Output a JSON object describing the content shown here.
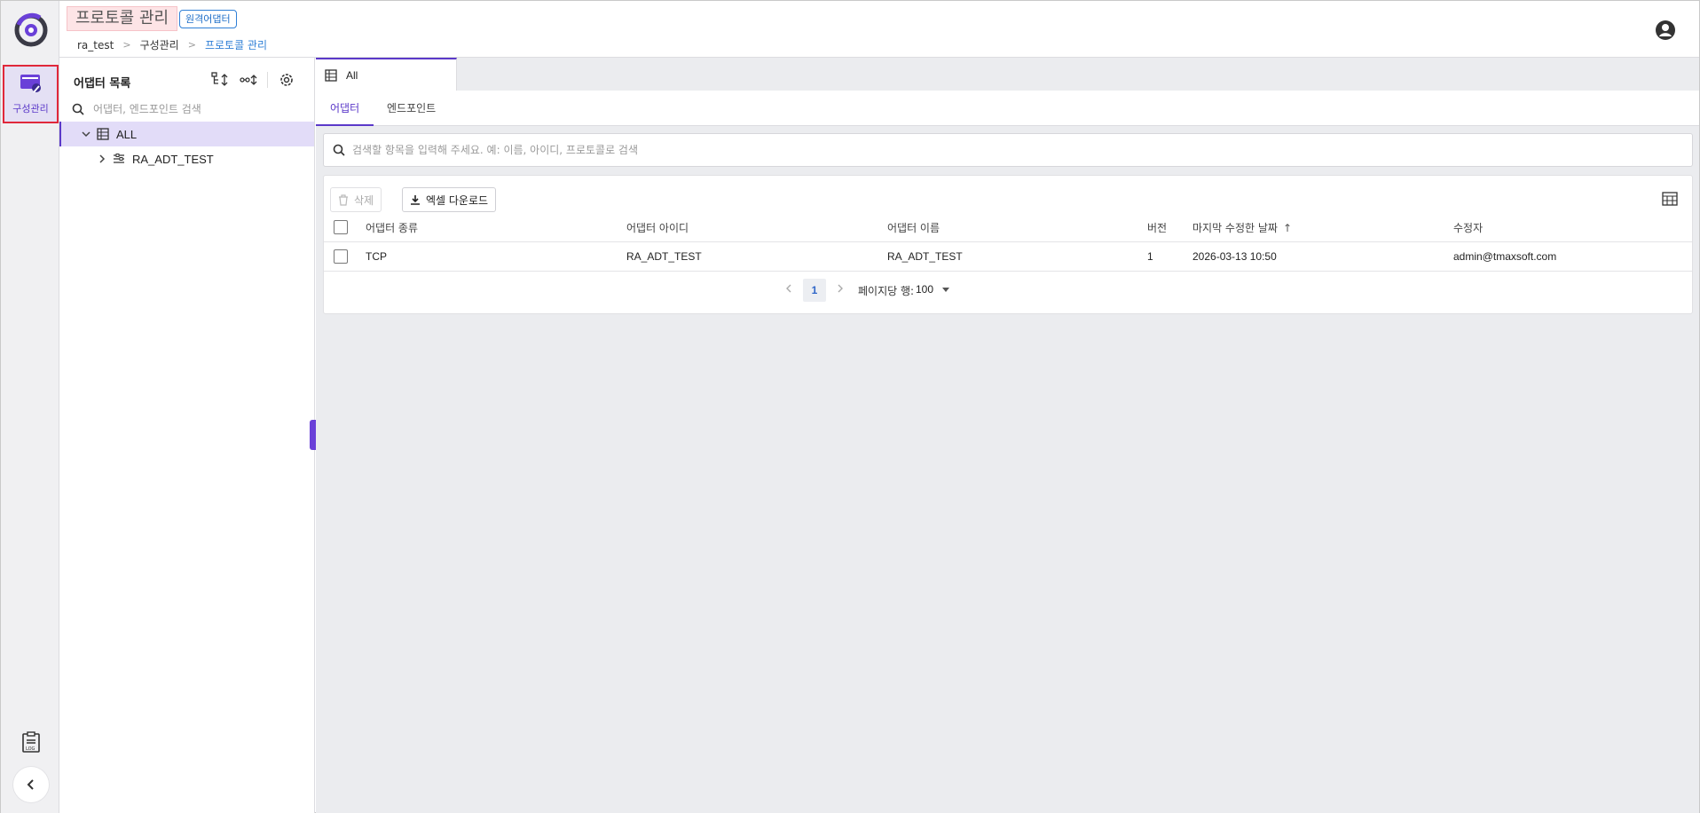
{
  "header": {
    "title": "프로토콜 관리",
    "badge": "원격어댑터",
    "breadcrumb": [
      "ra_test",
      "구성관리",
      "프로토콜 관리"
    ]
  },
  "rail": {
    "items": [
      {
        "label": "구성관리",
        "icon": "config-management-icon",
        "active": true
      }
    ],
    "log_icon": "log-icon",
    "collapse_icon": "chevron-left-icon"
  },
  "side_panel": {
    "title": "어댑터 목록",
    "search_placeholder": "어댑터, 엔드포인트 검색",
    "tree": [
      {
        "label": "ALL",
        "expanded": true,
        "selected": true,
        "icon": "table-list-icon"
      },
      {
        "label": "RA_ADT_TEST",
        "expanded": false,
        "selected": false,
        "icon": "adapter-icon"
      }
    ]
  },
  "main": {
    "doc_tab": "All",
    "subtabs": [
      "어댑터",
      "엔드포인트"
    ],
    "active_subtab": "어댑터",
    "search_placeholder": "검색할 항목을 입력해 주세요. 예: 이름, 아이디, 프로토콜로 검색",
    "toolbar": {
      "delete_label": "삭제",
      "excel_label": "엑셀 다운로드"
    },
    "table": {
      "columns": [
        "어댑터 종류",
        "어댑터 아이디",
        "어댑터 이름",
        "버전",
        "마지막 수정한 날짜",
        "수정자"
      ],
      "rows": [
        {
          "type": "TCP",
          "id": "RA_ADT_TEST",
          "name": "RA_ADT_TEST",
          "version": "1",
          "modified": "2026-03-13 10:50",
          "modifier": "admin@tmaxsoft.com"
        }
      ]
    },
    "pager": {
      "page": "1",
      "rows_label": "페이지당 행:",
      "rows_per_page": "100"
    }
  },
  "colors": {
    "accent": "#5b39c9",
    "link": "#2f7fd6",
    "highlight_border": "#e0283a"
  }
}
